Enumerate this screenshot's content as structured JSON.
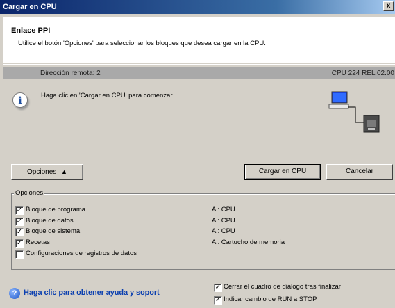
{
  "window": {
    "title": "Cargar en CPU",
    "close_symbol": "x"
  },
  "header": {
    "title": "Enlace PPI",
    "subtitle": "Utilice el botón 'Opciones' para seleccionar los bloques que desea cargar en la CPU."
  },
  "status_bar": {
    "remote_address": "Dirección remota: 2",
    "cpu_info": "CPU 224 REL 02.00"
  },
  "message": "Haga clic en 'Cargar en CPU' para comenzar.",
  "buttons": {
    "options": "Opciones",
    "options_arrow": "⯭",
    "load": "Cargar en CPU",
    "cancel": "Cancelar"
  },
  "options_group": {
    "legend": "Opciones",
    "items": [
      {
        "label": "Bloque de programa",
        "checked": true,
        "target": "A : CPU"
      },
      {
        "label": "Bloque de datos",
        "checked": true,
        "target": "A : CPU"
      },
      {
        "label": "Bloque de sistema",
        "checked": true,
        "target": "A : CPU"
      },
      {
        "label": "Recetas",
        "checked": true,
        "target": "A : Cartucho de memoria"
      },
      {
        "label": "Configuraciones de registros de datos",
        "checked": false,
        "target": ""
      }
    ]
  },
  "footer": {
    "help_link": "Haga clic para obtener ayuda y soport",
    "close_after": {
      "label": "Cerrar el cuadro de diálogo tras finalizar",
      "checked": true
    },
    "run_stop": {
      "label": "Indicar cambio de RUN a STOP",
      "checked": true
    }
  },
  "icons": {
    "info": "info-icon",
    "help": "help-icon",
    "network": "pc-plc-network-icon"
  },
  "colors": {
    "titlebar": "#0a246a",
    "face": "#d4d0c8",
    "link": "#0a3fb0"
  }
}
